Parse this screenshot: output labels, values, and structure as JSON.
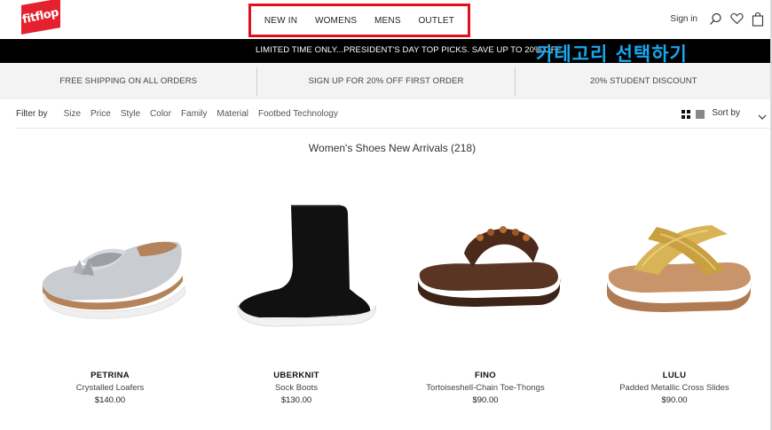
{
  "header": {
    "logo_text": "fitflop",
    "nav": [
      "NEW IN",
      "WOMENS",
      "MENS",
      "OUTLET"
    ],
    "signin": "Sign in",
    "icons": [
      "search-icon",
      "heart-icon",
      "bag-icon"
    ]
  },
  "promo": {
    "text": "LIMITED TIME ONLY...PRESIDENT'S DAY TOP PICKS. SAVE UP TO 20% OFF",
    "annotation": "카테고리 선택하기"
  },
  "benefits": [
    "FREE SHIPPING ON ALL ORDERS",
    "SIGN UP FOR 20% OFF FIRST ORDER",
    "20% STUDENT DISCOUNT"
  ],
  "filters": {
    "label": "Filter by",
    "items": [
      "Size",
      "Price",
      "Style",
      "Color",
      "Family",
      "Material",
      "Footbed Technology"
    ],
    "sort_label": "Sort by"
  },
  "listing": {
    "title": "Women's Shoes New Arrivals (218)"
  },
  "products": [
    {
      "name": "PETRINA",
      "desc": "Crystalled Loafers",
      "price": "$140.00"
    },
    {
      "name": "UBERKNIT",
      "desc": "Sock Boots",
      "price": "$130.00"
    },
    {
      "name": "FINO",
      "desc": "Tortoiseshell-Chain Toe-Thongs",
      "price": "$90.00"
    },
    {
      "name": "LULU",
      "desc": "Padded Metallic Cross Slides",
      "price": "$90.00"
    }
  ],
  "colors": {
    "brand": "#e4222f",
    "highlight_box": "#e0101b",
    "promo_bg": "#000000",
    "annotation": "#16a8f0"
  }
}
